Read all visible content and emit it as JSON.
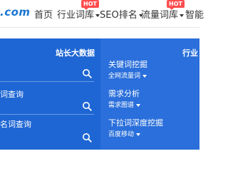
{
  "header": {
    "logo_text": ".com",
    "nav": [
      {
        "label": "首页",
        "hot": false,
        "dropdown": false
      },
      {
        "label": "行业词库",
        "hot": true,
        "dropdown": true
      },
      {
        "label": "SEO排名",
        "hot": false,
        "dropdown": true
      },
      {
        "label": "流量词库",
        "hot": true,
        "dropdown": true
      },
      {
        "label": "智能",
        "hot": false,
        "dropdown": false
      }
    ],
    "hot_badge": "HOT"
  },
  "panel": {
    "left_column_title": "站长大数据",
    "right_column_title": "行业",
    "left_items": [
      {
        "label": "词查询"
      },
      {
        "label": "名词查询"
      }
    ],
    "right_items": [
      {
        "title": "关键词挖掘",
        "subtitle": "全网流量词"
      },
      {
        "title": "需求分析",
        "subtitle": "需求图谱"
      },
      {
        "title": "下拉词深度挖掘",
        "subtitle": "百度移动"
      }
    ]
  },
  "colors": {
    "brand_blue": "#1b77d2",
    "panel_blue": "#1e66d4",
    "hot_red": "#ff4d4f"
  }
}
